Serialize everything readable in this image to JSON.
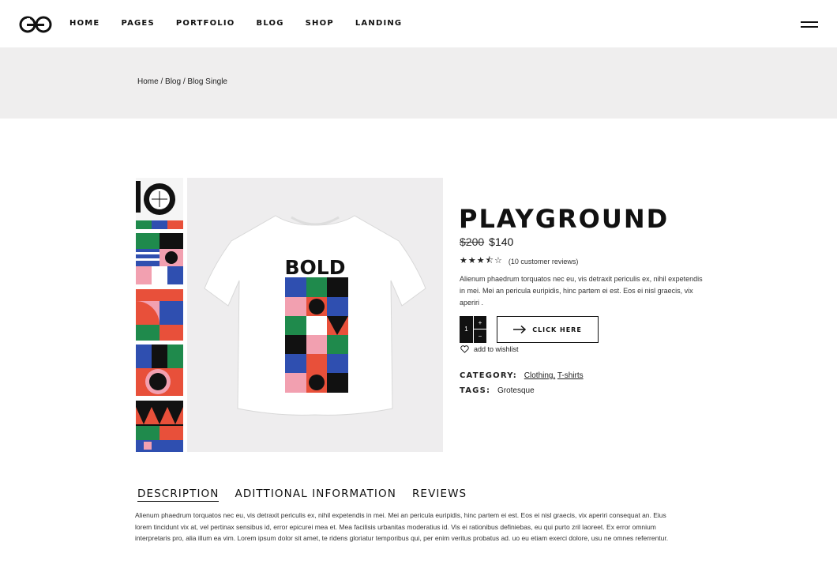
{
  "header": {
    "nav": [
      "HOME",
      "PAGES",
      "PORTFOLIO",
      "BLOG",
      "SHOP",
      "LANDING"
    ]
  },
  "breadcrumb": {
    "items": [
      "Home",
      "Blog",
      "Blog Single"
    ],
    "separator": " / "
  },
  "product": {
    "title": "PLAYGROUND",
    "old_price": "$200",
    "price": "$140",
    "rating": 3.5,
    "rating_max": 5,
    "stars": "★★★⯪☆",
    "reviews": "(10 customer reviews)",
    "description": "Alienum phaedrum torquatos nec eu, vis detraxit periculis ex, nihil expetendis in mei. Mei an pericula euripidis, hinc partem ei est. Eos ei nisl graecis, vix aperiri .",
    "quantity": "1",
    "qty_plus": "+",
    "qty_minus": "−",
    "cta": "CLICK HERE",
    "wishlist": "add to wishlist",
    "category_label": "CATEGORY:",
    "categories": [
      "Clothing,",
      "T-shirts"
    ],
    "tags_label": "TAGS:",
    "tags": "Grotesque",
    "tshirt_print": "BOLD"
  },
  "tabs": {
    "items": [
      "DESCRIPTION",
      "ADITTIONAL INFORMATION",
      "REVIEWS"
    ],
    "active": 0,
    "content": "Alienum phaedrum torquatos nec eu, vis detraxit periculis ex, nihil expetendis in mei. Mei an pericula euripidis, hinc partem ei est. Eos ei nisl graecis, vix aperiri consequat an. Eius lorem tincidunt vix at, vel pertinax sensibus id, error epicurei mea et. Mea facilisis urbanitas moderatius id. Vis ei rationibus definiebas, eu qui purto zril laoreet. Ex error omnium interpretaris pro, alia illum ea vim. Lorem ipsum dolor sit amet, te ridens gloriatur temporibus qui, per enim veritus probatus ad. uo eu etiam exerci dolore, usu ne omnes referrentur."
  },
  "colors": {
    "accent": "#111111",
    "band": "#efeeee",
    "image_bg": "#eeedee",
    "print_red": "#e8503a",
    "print_blue": "#2f4fb0",
    "print_green": "#1f8a4c",
    "print_pink": "#f2a0b0"
  }
}
